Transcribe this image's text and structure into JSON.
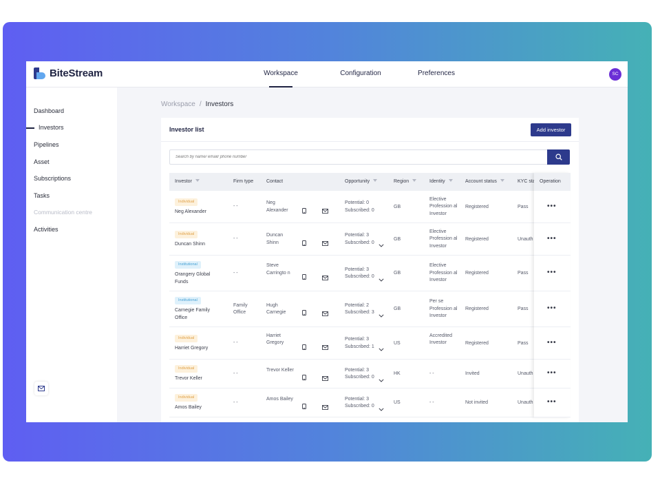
{
  "app": {
    "brand": "BiteStream"
  },
  "topnav": {
    "tabs": [
      "Workspace",
      "Configuration",
      "Preferences"
    ],
    "active": "Workspace"
  },
  "user": {
    "initials": "SC",
    "avatar_color": "#6b2fd6"
  },
  "sidebar": {
    "items": [
      {
        "label": "Dashboard",
        "state": "normal"
      },
      {
        "label": "Investors",
        "state": "active"
      },
      {
        "label": "Pipelines",
        "state": "normal"
      },
      {
        "label": "Asset",
        "state": "normal"
      },
      {
        "label": "Subscriptions",
        "state": "normal"
      },
      {
        "label": "Tasks",
        "state": "normal"
      },
      {
        "label": "Communication centre",
        "state": "disabled"
      },
      {
        "label": "Activities",
        "state": "normal"
      }
    ]
  },
  "breadcrumb": {
    "root": "Workspace",
    "current": "Investors"
  },
  "panel": {
    "title": "Investor list",
    "add_button": "Add investor"
  },
  "search": {
    "placeholder": "Search by name/ email/ phone number"
  },
  "table": {
    "columns": [
      "Investor",
      "Firm type",
      "Contact",
      "Opportunity",
      "Region",
      "Identity",
      "Account status",
      "KYC sta",
      "Operation"
    ],
    "rows": [
      {
        "type": "Individual",
        "name": "Neg Alexander",
        "firm": "- -",
        "contact": "Neg Alexander",
        "potential": "Potential: 0",
        "subscribed": "Subscribed: 0",
        "region": "GB",
        "identity": "Elective Profession al Investor",
        "account": "Registered",
        "kyc": "Pass"
      },
      {
        "type": "Individual",
        "name": "Duncan Shinn",
        "firm": "- -",
        "contact": "Duncan Shinn",
        "potential": "Potential: 3",
        "subscribed": "Subscribed: 0",
        "region": "GB",
        "identity": "Elective Profession al Investor",
        "account": "Registered",
        "kyc": "Unauth"
      },
      {
        "type": "Institutional",
        "name": "Orangery Global Funds",
        "firm": "- -",
        "contact": "Steve Carringto n",
        "potential": "Potential: 3",
        "subscribed": "Subscribed: 0",
        "region": "GB",
        "identity": "Elective Profession al Investor",
        "account": "Registered",
        "kyc": "Pass"
      },
      {
        "type": "Institutional",
        "name": "Carnegie Family Office",
        "firm": "Family Office",
        "contact": "Hugh Carnegie",
        "potential": "Potential: 2",
        "subscribed": "Subscribed: 3",
        "region": "GB",
        "identity": "Per se Profession al Investor",
        "account": "Registered",
        "kyc": "Pass"
      },
      {
        "type": "Individual",
        "name": "Harriet Gregory",
        "firm": "- -",
        "contact": "Harriet Gregory",
        "potential": "Potential: 3",
        "subscribed": "Subscribed: 1",
        "region": "US",
        "identity": "Accredited Investor",
        "account": "Registered",
        "kyc": "Pass"
      },
      {
        "type": "Individual",
        "name": "Trevor Keller",
        "firm": "- -",
        "contact": "Trevor Keller",
        "potential": "Potential: 3",
        "subscribed": "Subscribed: 0",
        "region": "HK",
        "identity": "- -",
        "account": "Invited",
        "kyc": "Unauth"
      },
      {
        "type": "Individual",
        "name": "Amos Bailey",
        "firm": "- -",
        "contact": "Amos Bailey",
        "potential": "Potential: 3",
        "subscribed": "Subscribed: 0",
        "region": "US",
        "identity": "- -",
        "account": "Not invited",
        "kyc": "Unauth"
      }
    ]
  },
  "colors": {
    "primary": "#2d3a8c",
    "individual_tag": "#e0a24a",
    "institutional_tag": "#4aa3d5"
  },
  "icons": {
    "search": "search-icon",
    "phone": "phone-icon",
    "mail": "mail-icon",
    "more": "more-dots-icon",
    "filter": "filter-icon"
  }
}
